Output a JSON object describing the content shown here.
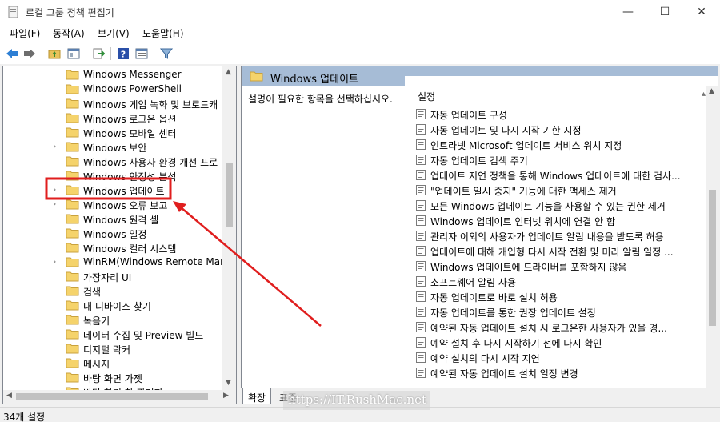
{
  "window": {
    "title": "로컬 그룹 정책 편집기",
    "minimize_glyph": "—",
    "maximize_glyph": "☐",
    "close_glyph": "✕"
  },
  "menu": [
    "파일(F)",
    "동작(A)",
    "보기(V)",
    "도움말(H)"
  ],
  "toolbar": {
    "icons": [
      "back-arrow-icon",
      "forward-arrow-icon",
      "up-folder-icon",
      "show-hide-tree-icon",
      "export-list-icon",
      "help-icon",
      "properties-icon",
      "filter-icon"
    ]
  },
  "tree": {
    "items": [
      {
        "label": "Windows Messenger",
        "expandable": false
      },
      {
        "label": "Windows PowerShell",
        "expandable": false
      },
      {
        "label": "Windows 게임 녹화 및 브로드캐",
        "expandable": false
      },
      {
        "label": "Windows 로그온 옵션",
        "expandable": false
      },
      {
        "label": "Windows 모바일 센터",
        "expandable": false
      },
      {
        "label": "Windows 보안",
        "expandable": true
      },
      {
        "label": "Windows 사용자 환경 개선 프로",
        "expandable": false
      },
      {
        "label": "Windows 안정성 분석",
        "expandable": false
      },
      {
        "label": "Windows 업데이트",
        "expandable": true
      },
      {
        "label": "Windows 오류 보고",
        "expandable": true
      },
      {
        "label": "Windows 원격 셸",
        "expandable": false
      },
      {
        "label": "Windows 일정",
        "expandable": false
      },
      {
        "label": "Windows 컬러 시스템",
        "expandable": false
      },
      {
        "label": "WinRM(Windows Remote Manag",
        "expandable": true
      },
      {
        "label": "가장자리 UI",
        "expandable": false
      },
      {
        "label": "검색",
        "expandable": false
      },
      {
        "label": "내 디바이스 찾기",
        "expandable": false
      },
      {
        "label": "녹음기",
        "expandable": false
      },
      {
        "label": "데이터 수집 및 Preview 빌드",
        "expandable": false
      },
      {
        "label": "디지털 락커",
        "expandable": false
      },
      {
        "label": "메시지",
        "expandable": false
      },
      {
        "label": "바탕 화면 가젯",
        "expandable": false
      },
      {
        "label": "바탕 화면 창 관리자",
        "expandable": false
      }
    ],
    "expand_glyph": "›"
  },
  "detail": {
    "header": "Windows 업데이트",
    "description": "설명이 필요한 항목을 선택하십시오.",
    "column_header": "설정",
    "policies": [
      "자동 업데이트 구성",
      "자동 업데이트 및 다시 시작 기한 지정",
      "인트라넷 Microsoft 업데이트 서비스 위치 지정",
      "자동 업데이트 검색 주기",
      "업데이트 지연 정책을 통해 Windows 업데이트에 대한 검사...",
      "\"업데이트 일시 중지\" 기능에 대한 액세스 제거",
      "모든 Windows 업데이트 기능을 사용할 수 있는 권한 제거",
      "Windows 업데이트 인터넷 위치에 연결 안 함",
      "관리자 이외의 사용자가 업데이트 알림 내용을 받도록 허용",
      "업데이트에 대해 개입형 다시 시작 전환 및 미리 알림 일정 ...",
      "Windows 업데이트에 드라이버를 포함하지 않음",
      "소프트웨어 알림 사용",
      "자동 업데이트로 바로 설치 허용",
      "자동 업데이트를 통한 권장 업데이트 설정",
      "예약된 자동 업데이트 설치 시 로그온한 사용자가 있을 경...",
      "예약 설치 후 다시 시작하기 전에 다시 확인",
      "예약 설치의 다시 시작 지연",
      "예약된 자동 업데이트 설치 일정 변경"
    ]
  },
  "tabs": [
    "확장",
    "표준"
  ],
  "status": "34개 설정",
  "watermark": "https://IT.RushMac.net",
  "colors": {
    "detail_header_bg": "#a6bcd6",
    "highlight_box": "#e01e1e",
    "arrow": "#e01e1e",
    "folder": "#f5d36b"
  }
}
